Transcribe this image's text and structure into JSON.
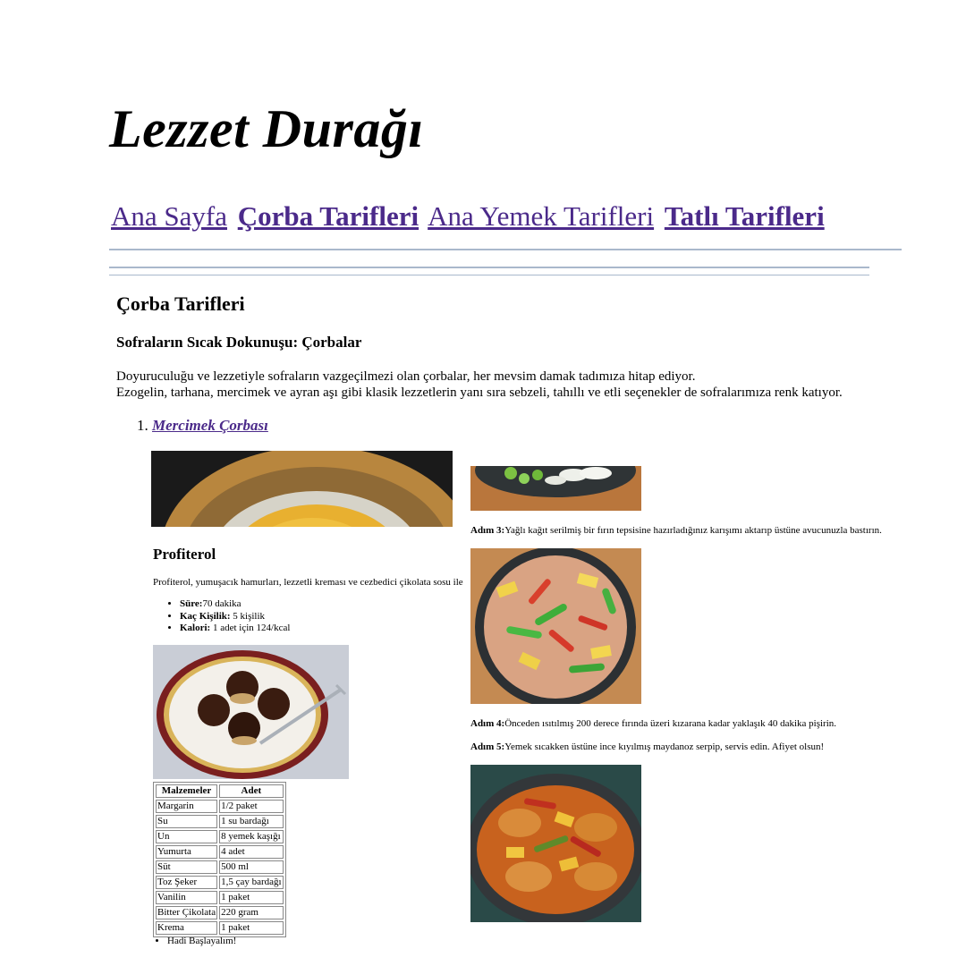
{
  "site": {
    "title": "Lezzet Durağı"
  },
  "nav": {
    "home": "Ana Sayfa",
    "soups": "Çorba Tarifleri",
    "mains": "Ana Yemek Tarifleri",
    "desserts": "Tatlı Tarifleri"
  },
  "section": {
    "title": "Çorba Tarifleri",
    "subtitle": "Sofraların Sıcak Dokunuşu: Çorbalar",
    "intro_line1": "Doyuruculuğu ve lezzetiyle sofraların vazgeçilmezi olan çorbalar, her mevsim damak tadımıza hitap ediyor.",
    "intro_line2": "Ezogelin, tarhana, mercimek ve ayran aşı gibi klasik lezzetlerin yanı sıra sebzeli, tahıllı ve etli seçenekler de sofralarımıza renk katıyor."
  },
  "recipes": [
    {
      "number": "1.",
      "title": "Mercimek Çorbası"
    }
  ],
  "profiterol": {
    "title": "Profiterol",
    "description": "Profiterol, yumuşacık hamurları, lezzetli kreması ve cezbedici çikolata sosu ile",
    "info": [
      {
        "label": "Süre:",
        "value": "70 dakika"
      },
      {
        "label": "Kaç Kişilik:",
        "value": " 5 kişilik"
      },
      {
        "label": "Kalori:",
        "value": " 1 adet için 124/kcal"
      }
    ],
    "table": {
      "headers": [
        "Malzemeler",
        "Adet"
      ],
      "rows": [
        [
          "Margarin",
          "1/2 paket"
        ],
        [
          "Su",
          "1 su bardağı"
        ],
        [
          "Un",
          "8 yemek kaşığı"
        ],
        [
          "Yumurta",
          "4 adet"
        ],
        [
          "Süt",
          "500 ml"
        ],
        [
          "Toz Şeker",
          "1,5 çay bardağı"
        ],
        [
          "Vanilin",
          "1 paket"
        ],
        [
          "Bitter Çikolata",
          "220 gram"
        ],
        [
          "Krema",
          "1 paket"
        ]
      ]
    },
    "start": "Hadi Başlayalım!"
  },
  "steps": [
    {
      "label": "Adım 3:",
      "text": "Yağlı kağıt serilmiş bir fırın tepsisine hazırladığınız karışımı aktarıp üstüne avucunuzla bastırın."
    },
    {
      "label": "Adım 4:",
      "text": "Önceden ısıtılmış 200 derece fırında üzeri kızarana kadar yaklaşık 40 dakika pişirin."
    },
    {
      "label": "Adım 5:",
      "text": "Yemek sıcakken üstüne ince kıyılmış maydanoz serpip, servis edin. Afiyet olsun!"
    }
  ],
  "colors": {
    "link": "#4b2a8a",
    "rule": "#a9b8cc"
  }
}
